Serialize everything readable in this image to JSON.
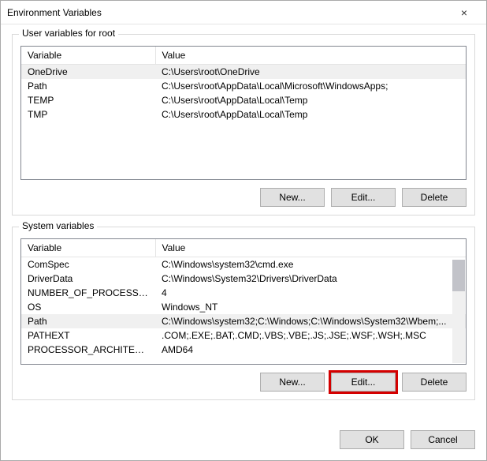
{
  "window": {
    "title": "Environment Variables",
    "close_icon": "×"
  },
  "user_group": {
    "legend": "User variables for root",
    "col_variable": "Variable",
    "col_value": "Value",
    "rows": [
      {
        "variable": "OneDrive",
        "value": "C:\\Users\\root\\OneDrive",
        "selected": true
      },
      {
        "variable": "Path",
        "value": "C:\\Users\\root\\AppData\\Local\\Microsoft\\WindowsApps;",
        "selected": false
      },
      {
        "variable": "TEMP",
        "value": "C:\\Users\\root\\AppData\\Local\\Temp",
        "selected": false
      },
      {
        "variable": "TMP",
        "value": "C:\\Users\\root\\AppData\\Local\\Temp",
        "selected": false
      }
    ],
    "buttons": {
      "new": "New...",
      "edit": "Edit...",
      "delete": "Delete"
    }
  },
  "system_group": {
    "legend": "System variables",
    "col_variable": "Variable",
    "col_value": "Value",
    "rows": [
      {
        "variable": "ComSpec",
        "value": "C:\\Windows\\system32\\cmd.exe",
        "selected": false
      },
      {
        "variable": "DriverData",
        "value": "C:\\Windows\\System32\\Drivers\\DriverData",
        "selected": false
      },
      {
        "variable": "NUMBER_OF_PROCESSORS",
        "value": "4",
        "selected": false
      },
      {
        "variable": "OS",
        "value": "Windows_NT",
        "selected": false
      },
      {
        "variable": "Path",
        "value": "C:\\Windows\\system32;C:\\Windows;C:\\Windows\\System32\\Wbem;...",
        "selected": true
      },
      {
        "variable": "PATHEXT",
        "value": ".COM;.EXE;.BAT;.CMD;.VBS;.VBE;.JS;.JSE;.WSF;.WSH;.MSC",
        "selected": false
      },
      {
        "variable": "PROCESSOR_ARCHITECTURE",
        "value": "AMD64",
        "selected": false
      }
    ],
    "buttons": {
      "new": "New...",
      "edit": "Edit...",
      "delete": "Delete"
    }
  },
  "footer": {
    "ok": "OK",
    "cancel": "Cancel"
  }
}
